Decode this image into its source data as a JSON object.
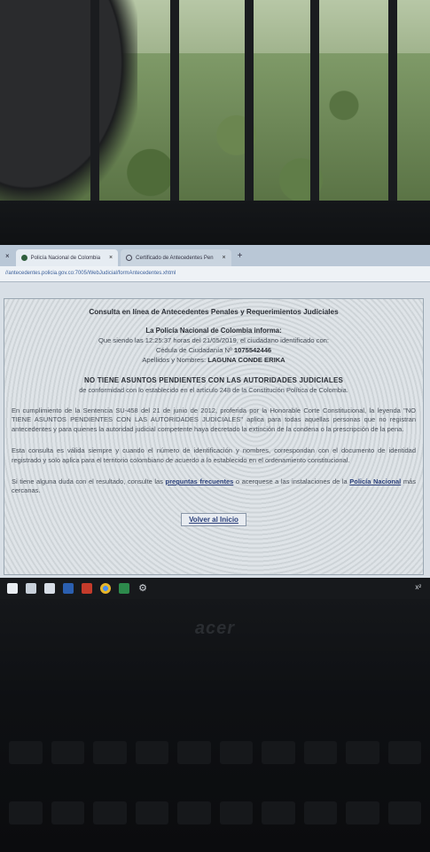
{
  "browser": {
    "tabs": [
      {
        "label": "Policía Nacional de Colombia",
        "active": true
      },
      {
        "label": "Certificado de Antecedentes Pen",
        "active": false
      }
    ],
    "close_glyph": "×",
    "left_close_glyph": "×",
    "new_tab_glyph": "+",
    "url": "//antecedentes.policia.gov.co:7005/WebJudicial/formAntecedentes.xhtml"
  },
  "page": {
    "title": "Consulta en línea de Antecedentes Penales y Requerimientos Judiciales",
    "informa_heading": "La Policía Nacional de Colombia informa:",
    "date_line": "Que siendo las 12:25:37 horas del 21/05/2019, el ciudadano identificado con:",
    "cedula_line_prefix": "Cédula de Ciudadanía Nº",
    "cedula_number": "1075542446",
    "names_prefix": "Apellidos y Nombres:",
    "names_value": "LAGUNA CONDE ERIKA",
    "status": "NO TIENE ASUNTOS PENDIENTES CON LAS AUTORIDADES JUDICIALES",
    "status_sub": "de conformidad con lo establecido en el artículo 248 de la Constitución Política de Colombia.",
    "paragraph1": "En cumplimiento de la Sentencia SU-458 del 21 de junio de 2012, proferida por la Honorable Corte Constitucional, la leyenda \"NO TIENE ASUNTOS PENDIENTES CON LAS AUTORIDADES JUDICIALES\" aplica para todas aquellas personas que no registran antecedentes y para quienes la autoridad judicial competente haya decretado la extinción de la condena o la prescripción de la pena.",
    "paragraph2": "Esta consulta es válida siempre y cuando el número de identificación y nombres, correspondan con el documento de identidad registrado y solo aplica para el territorio colombiano de acuerdo a lo establecido en el ordenamiento constitucional.",
    "paragraph3_prefix": "Si tiene alguna duda con el resultado, consulte las",
    "paragraph3_link1": "preguntas frecuentes",
    "paragraph3_middle": "o acerquese a las instalaciones de la",
    "paragraph3_link2": "Policía Nacional",
    "paragraph3_suffix": "más cercanas.",
    "back_button": "Volver al Inicio"
  },
  "laptop": {
    "brand": "acer"
  },
  "taskbar": {
    "icons": [
      "task-view-icon",
      "mail-icon",
      "store-icon",
      "word-icon",
      "powerpoint-icon",
      "chrome-icon",
      "excel-icon",
      "settings-icon"
    ],
    "tray_glyph": "x²"
  }
}
